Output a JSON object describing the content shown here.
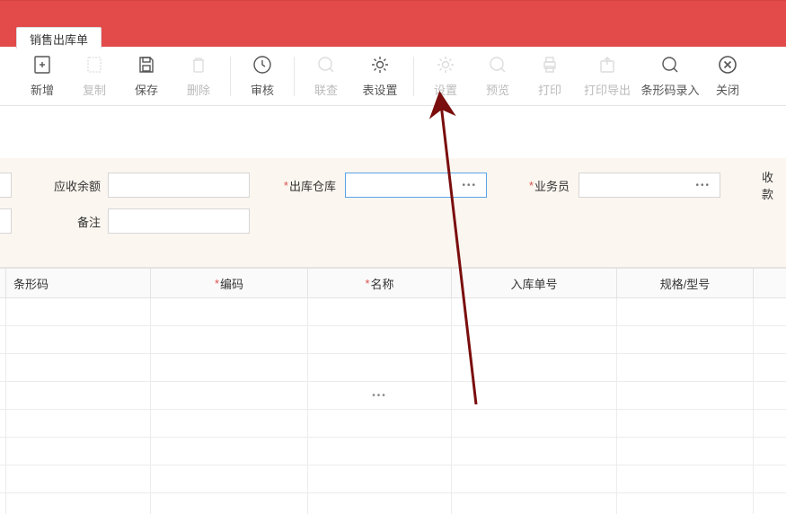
{
  "tab": {
    "title": "销售出库单"
  },
  "toolbar": {
    "new": "新增",
    "copy": "复制",
    "save": "保存",
    "delete": "删除",
    "audit": "审核",
    "lookup": "联查",
    "table_settings": "表设置",
    "settings": "设置",
    "preview": "预览",
    "print": "打印",
    "print_export": "打印导出",
    "barcode_entry": "条形码录入",
    "close": "关闭"
  },
  "form": {
    "balance_label": "应收余额",
    "balance_value": "",
    "warehouse_label": "出库仓库",
    "warehouse_value": "",
    "salesman_label": "业务员",
    "salesman_value": "",
    "remark_label": "备注",
    "remark_value": "",
    "receipt_partial_label": "收款"
  },
  "table": {
    "headers": {
      "barcode": "条形码",
      "code": "编码",
      "name": "名称",
      "in_no": "入库单号",
      "spec": "规格/型号"
    },
    "rows": [
      {},
      {},
      {},
      {
        "name_ellipsis": true
      },
      {},
      {},
      {},
      {}
    ]
  },
  "colors": {
    "primary_red": "#e24b4a",
    "form_bg": "#fbf6ef",
    "border": "#e3e3e3",
    "arrow": "#7a0d0d"
  },
  "chart_data": null
}
